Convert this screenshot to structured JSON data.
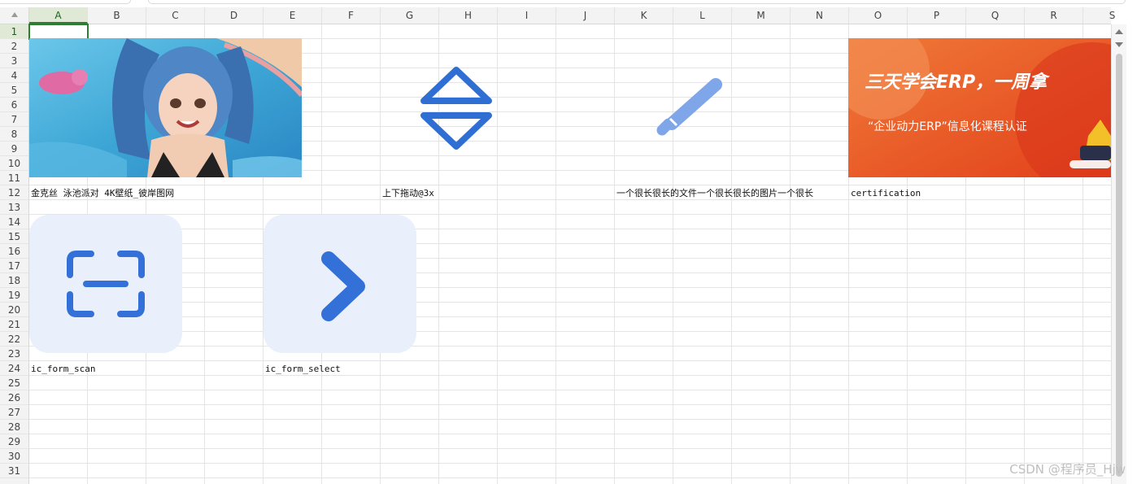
{
  "columns": [
    "A",
    "B",
    "C",
    "D",
    "E",
    "F",
    "G",
    "H",
    "I",
    "J",
    "K",
    "L",
    "M",
    "N",
    "O",
    "P",
    "Q",
    "R",
    "S"
  ],
  "rows": [
    "1",
    "2",
    "3",
    "4",
    "5",
    "6",
    "7",
    "8",
    "9",
    "10",
    "11",
    "12",
    "13",
    "14",
    "15",
    "16",
    "17",
    "18",
    "19",
    "20",
    "21",
    "22",
    "23",
    "24",
    "25",
    "26",
    "27",
    "28",
    "29",
    "30",
    "31"
  ],
  "selected_cell": "A1",
  "cells": {
    "A12": "金克丝 泳池派对 4K壁纸_彼岸图网",
    "G12": "上下拖动@3x",
    "K12": "一个很长很长的文件一个很长很长的图片一个很长",
    "O12": "certification",
    "A24": "ic_form_scan",
    "E24": "ic_form_select"
  },
  "images": {
    "banner_title": "三天学会ERP，一周拿",
    "banner_subtitle": "“企业动力ERP”信息化课程认证",
    "colors": {
      "scan_bg": "#e9f0fc",
      "icon_blue": "#3370d8",
      "pencil_blue": "#7fa6e8",
      "banner_orange": "#e8501e",
      "pool_blue": "#3ea7d6"
    }
  },
  "watermark": "CSDN @程序员_Hjw"
}
